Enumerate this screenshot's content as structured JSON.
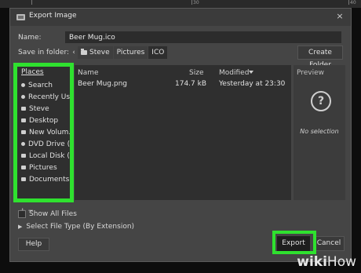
{
  "gimp_strip": {
    "numbers": [
      "30",
      "40"
    ]
  },
  "dialog": {
    "title": "Export Image",
    "close_glyph": "×",
    "name_label": "Name:",
    "name_value": "Beer Mug.ico",
    "save_in_label": "Save in folder:",
    "breadcrumb": {
      "back_glyph": "‹",
      "items": [
        "Steve",
        "Pictures",
        "ICO"
      ]
    },
    "create_folder_label": "Create Folder"
  },
  "places": {
    "header": "Places",
    "items": [
      {
        "label": "Search",
        "icon": "search-icon"
      },
      {
        "label": "Recently Us...",
        "icon": "recent-icon"
      },
      {
        "label": "Steve",
        "icon": "home-folder-icon"
      },
      {
        "label": "Desktop",
        "icon": "desktop-folder-icon"
      },
      {
        "label": "New Volum...",
        "icon": "drive-icon"
      },
      {
        "label": "DVD Drive (...",
        "icon": "dvd-drive-icon"
      },
      {
        "label": "Local Disk (...",
        "icon": "disk-icon"
      },
      {
        "label": "Pictures",
        "icon": "pictures-folder-icon"
      },
      {
        "label": "Documents",
        "icon": "documents-folder-icon"
      }
    ],
    "add_remove": "+ −"
  },
  "file_list": {
    "columns": {
      "name": "Name",
      "size": "Size",
      "modified": "Modified"
    },
    "rows": [
      {
        "name": "Beer Mug.png",
        "size": "174.7 kB",
        "modified": "Yesterday at 23:30"
      }
    ]
  },
  "preview": {
    "title": "Preview",
    "icon": "question-icon",
    "glyph": "?",
    "text": "No selection"
  },
  "options": {
    "show_all_files": "Show All Files",
    "select_file_type": "Select File Type (By Extension)",
    "expander_glyph": "▶"
  },
  "buttons": {
    "help": "Help",
    "export": "Export",
    "cancel": "Cancel"
  },
  "watermark": {
    "wiki": "wiki",
    "how": "How"
  },
  "colors": {
    "highlight": "#2fe12f",
    "dialog_bg": "#454545",
    "panel_bg": "#2f2f2f"
  }
}
